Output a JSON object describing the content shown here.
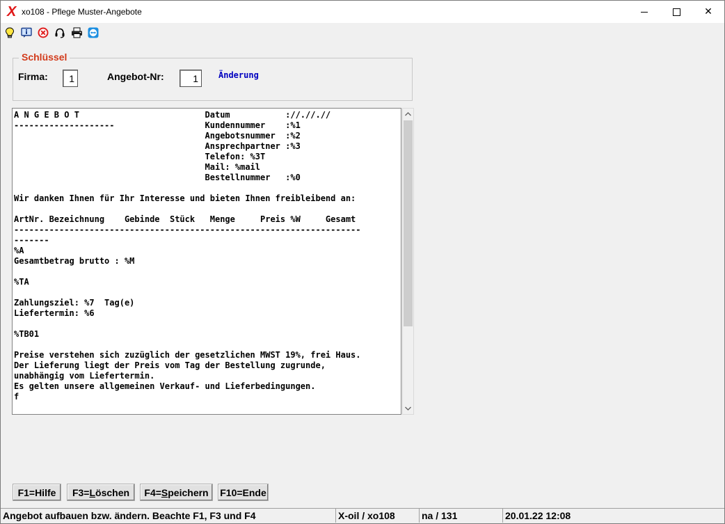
{
  "window": {
    "app_icon": "X",
    "title": "xo108 - Pflege Muster-Angebote",
    "minimize_icon": "minimize-icon",
    "maximize_icon": "maximize-icon",
    "close_symbol": "✕"
  },
  "toolbar": {
    "icons": [
      "lightbulb-icon",
      "info-icon",
      "cancel-icon",
      "headset-icon",
      "print-icon",
      "teamviewer-icon"
    ]
  },
  "key_group": {
    "legend": "Schlüssel",
    "firma_label": "Firma:",
    "firma_value": "1",
    "angebot_label": "Angebot-Nr:",
    "angebot_value": "1",
    "mode": "Änderung"
  },
  "text_area": {
    "content": "A N G E B O T                         Datum           :/​/.//.//\n--------------------                  Kundennummer    :%1\n                                      Angebotsnummer  :%2\n                                      Ansprechpartner :%3\n                                      Telefon: %3T\n                                      Mail: %mail\n                                      Bestellnummer   :%0\n\nWir danken Ihnen für Ihr Interesse und bieten Ihnen freibleibend an:\n\nArtNr. Bezeichnung    Gebinde  Stück   Menge     Preis %W     Gesamt\n---------------------------------------------------------------------\n-------\n%A\nGesamtbetrag brutto : %M\n\n%TA\n\nZahlungsziel: %7  Tag(e)\nLiefertermin: %6\n\n%TB01\n\nPreise verstehen sich zuzüglich der gesetzlichen MWST 19%, frei Haus.\nDer Lieferung liegt der Preis vom Tag der Bestellung zugrunde,\nunabhängig vom Liefertermin.\nEs gelten unsere allgemeinen Verkauf- und Lieferbedingungen.\nf"
  },
  "buttons": {
    "help": "F1=Hilfe",
    "delete_prefix": "F3=",
    "delete_key": "L",
    "delete_rest": "öschen",
    "save_prefix": "F4=",
    "save_key": "S",
    "save_rest": "peichern",
    "end": "F10=Ende"
  },
  "status_bar": {
    "message": "Angebot aufbauen bzw. ändern. Beachte F1, F3 und F4",
    "program": "X-oil / xo108",
    "user": "na / 131",
    "datetime": "20.01.22 12:08"
  }
}
